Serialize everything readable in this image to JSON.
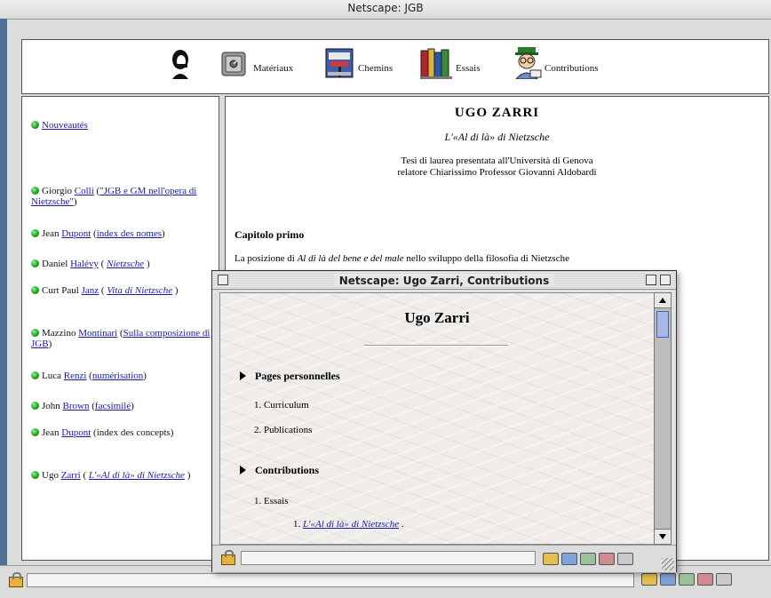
{
  "main_window": {
    "title": "Netscape: JGB"
  },
  "toolbar": {
    "items": [
      {
        "icon": "nietzsche-portrait-icon",
        "label": ""
      },
      {
        "icon": "safe-icon",
        "label": "Matériaux"
      },
      {
        "icon": "signpost-icon",
        "label": "Chemins"
      },
      {
        "icon": "books-icon",
        "label": "Essais"
      },
      {
        "icon": "contributor-figure-icon",
        "label": "Contributions"
      }
    ]
  },
  "sidebar": {
    "news": "Nouveautés",
    "entries": [
      {
        "name": "Giorgio",
        "author": "Colli",
        "pre": " (",
        "work": "\"JGB e GM nell'opera di Nietzsche\"",
        "post": ")"
      },
      {
        "name": "Jean",
        "author": "Dupont",
        "pre": " (",
        "work": "index des nomes",
        "post": ")"
      },
      {
        "name": "Daniel",
        "author": "Halévy",
        "pre": " ( ",
        "work": "Nietzsche",
        "post": " )"
      },
      {
        "name": "Curt Paul",
        "author": "Janz",
        "pre": " ( ",
        "work": "Vita di Nietzsche",
        "post": " )"
      },
      {
        "name": "Mazzino",
        "author": "Montinari",
        "pre": " (",
        "work": "Sulla composizione di JGB",
        "post": ")"
      },
      {
        "name": "Luca",
        "author": "Renzi",
        "pre": " (",
        "work": "numérisation",
        "post": ")"
      },
      {
        "name": "John",
        "author": "Brown",
        "pre": " (",
        "work": "facsimilé",
        "post": ")"
      },
      {
        "name": "Jean",
        "author": "Dupont",
        "pre": " (",
        "work": "",
        "post": "index des concepts)"
      },
      {
        "name": "Ugo",
        "author": "Zarri",
        "pre": " ( ",
        "work": "L'«Al di là» di Nietzsche",
        "post": " )"
      }
    ]
  },
  "right_frame": {
    "title": "UGO ZARRI",
    "subtitle": "L'«Al di là» di Nietzsche",
    "thesis_line1": "Tesi di laurea presentata all'Università di Genova",
    "thesis_line2": "relatore Chiarissimo Professor Giovanni Aldobardi",
    "chapter": "Capitolo primo",
    "text_pre": "La posizione di ",
    "text_italic": "Al di là del bene e del male",
    "text_post": "  nello sviluppo della filosofia di Nietzsche"
  },
  "popup": {
    "title": "Netscape: Ugo Zarri, Contributions",
    "heading": "Ugo Zarri",
    "section1": "Pages personnelles",
    "section1_items": [
      "1. Curriculum",
      "2. Publications"
    ],
    "section2": "Contributions",
    "section2_item": "1. Essais",
    "section2_subitem_num": "1.",
    "section2_subitem_link": "L'«Al di là» di Nietzsche",
    "section2_subitem_end": " ."
  }
}
